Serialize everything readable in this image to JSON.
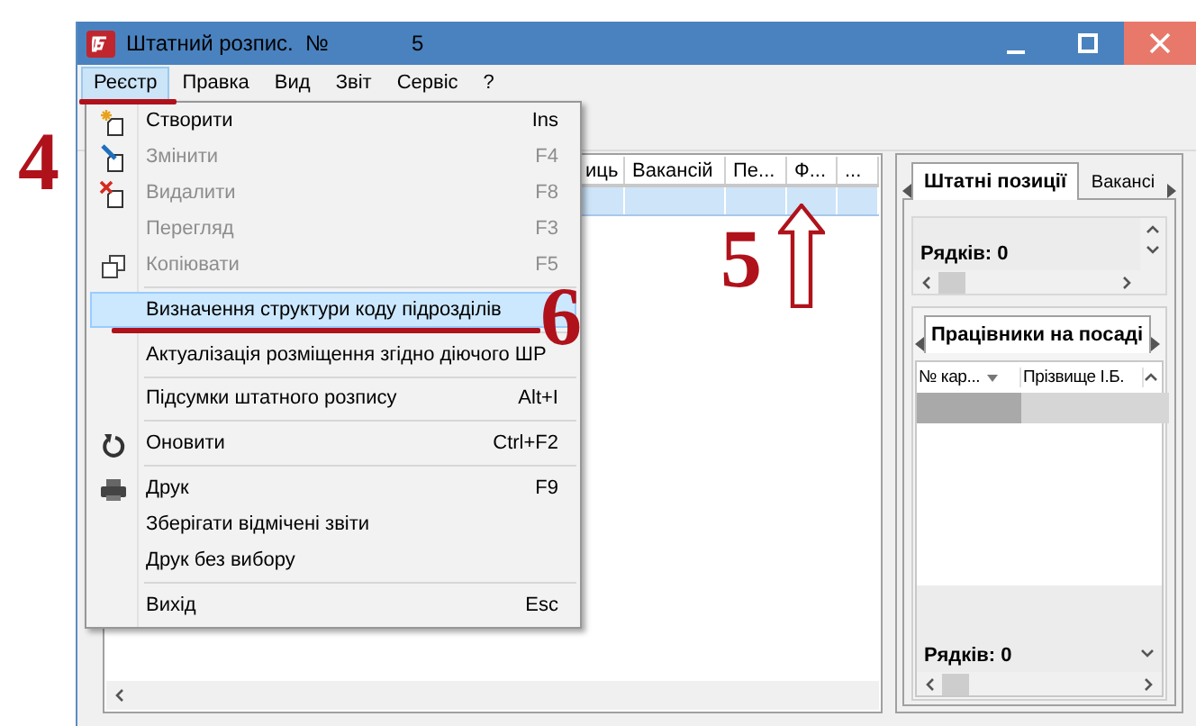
{
  "window": {
    "title": "Штатний розпис.  №",
    "number": "5"
  },
  "menu_bar": [
    {
      "label": "Реєстр",
      "selected": true
    },
    {
      "label": "Правка",
      "selected": false
    },
    {
      "label": "Вид",
      "selected": false
    },
    {
      "label": "Звіт",
      "selected": false
    },
    {
      "label": "Сервіс",
      "selected": false
    },
    {
      "label": "?",
      "selected": false
    }
  ],
  "dropdown": [
    {
      "kind": "item",
      "label": "Створити",
      "shortcut": "Ins",
      "disabled": false,
      "selected": false
    },
    {
      "kind": "item",
      "label": "Змінити",
      "shortcut": "F4",
      "disabled": true,
      "selected": false
    },
    {
      "kind": "item",
      "label": "Видалити",
      "shortcut": "F8",
      "disabled": true,
      "selected": false
    },
    {
      "kind": "item",
      "label": "Перегляд",
      "shortcut": "F3",
      "disabled": true,
      "selected": false
    },
    {
      "kind": "item",
      "label": "Копіювати",
      "shortcut": "F5",
      "disabled": true,
      "selected": false
    },
    {
      "kind": "separator"
    },
    {
      "kind": "item",
      "label": "Визначення структури коду підрозділів",
      "disabled": false,
      "selected": true
    },
    {
      "kind": "separator"
    },
    {
      "kind": "item",
      "label": "Актуалізація розміщення згідно діючого ШР",
      "disabled": false,
      "selected": false
    },
    {
      "kind": "separator"
    },
    {
      "kind": "item",
      "label": "Підсумки штатного розпису",
      "shortcut": "Alt+I",
      "disabled": false,
      "selected": false
    },
    {
      "kind": "separator"
    },
    {
      "kind": "item",
      "label": "Оновити",
      "shortcut": "Ctrl+F2",
      "disabled": false,
      "selected": false
    },
    {
      "kind": "separator"
    },
    {
      "kind": "item",
      "label": "Друк",
      "shortcut": "F9",
      "disabled": false,
      "selected": false
    },
    {
      "kind": "item",
      "label": "Зберігати відмічені звіти",
      "disabled": false,
      "selected": false
    },
    {
      "kind": "item",
      "label": "Друк без вибору",
      "disabled": false,
      "selected": false
    },
    {
      "kind": "separator"
    },
    {
      "kind": "item",
      "label": "Вихід",
      "shortcut": "Esc",
      "disabled": false,
      "selected": false
    }
  ],
  "grid": {
    "columns": [
      "иць",
      "Вакансій",
      "Пе...",
      "Ф...",
      "..."
    ],
    "rows": [
      {
        "selected": true
      }
    ]
  },
  "right_panel": {
    "tabs": [
      {
        "label": "Штатні позиції",
        "selected": true
      },
      {
        "label": "Вакансі",
        "selected": false
      }
    ],
    "positions_footer": "Рядків: 0",
    "subtabs": [
      {
        "label": "Працівники на посаді",
        "selected": true
      }
    ],
    "employees": {
      "columns": [
        "№ кар...",
        "Прізвище І.Б."
      ],
      "rows": [
        {
          "selected": true
        }
      ]
    },
    "employees_footer": "Рядків: 0"
  },
  "annotations": [
    {
      "text": "4"
    },
    {
      "text": "5"
    },
    {
      "text": "6"
    }
  ]
}
